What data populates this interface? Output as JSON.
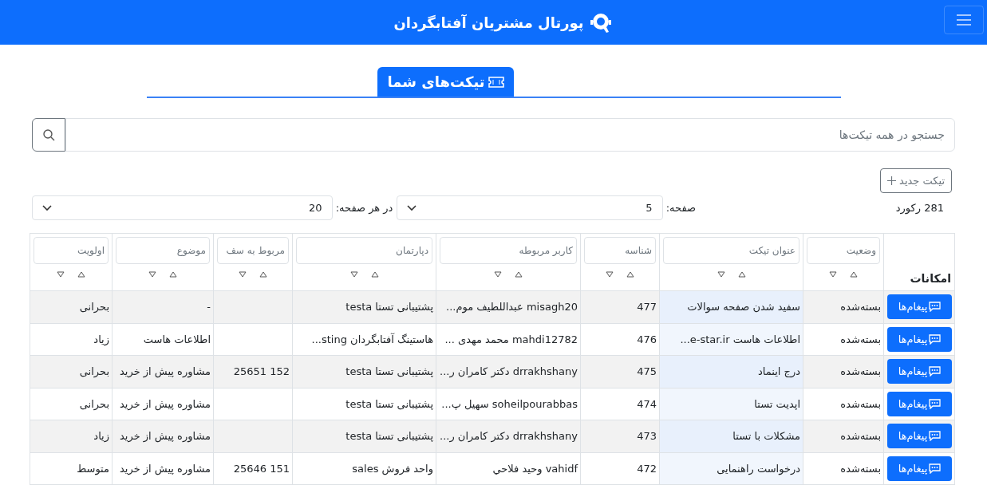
{
  "navbar": {
    "title": "پورتال مشتریان آفتابگردان"
  },
  "page_title": "تیکت‌های شما",
  "search": {
    "placeholder": "جستجو در همه تیکت‌ها"
  },
  "new_ticket_button": {
    "label": "تیکت جدید"
  },
  "record_count": "281 رکورد",
  "page_select": {
    "label": "صفحه:",
    "value": "5"
  },
  "per_page_select": {
    "label": "در هر صفحه:",
    "value": "20"
  },
  "table": {
    "actions_header": "امکانات",
    "columns": [
      {
        "placeholder": "وضعیت"
      },
      {
        "placeholder": "عنوان تیکت"
      },
      {
        "placeholder": "شناسه"
      },
      {
        "placeholder": "کاربر مربوطه"
      },
      {
        "placeholder": "دپارتمان"
      },
      {
        "placeholder": "مربوط به سف"
      },
      {
        "placeholder": "موضوع"
      },
      {
        "placeholder": "اولویت"
      }
    ],
    "rows": [
      {
        "action": "پیغام‌ها",
        "cells": [
          "بسته‌شده",
          "سفید شدن صفحه سوالات",
          "477",
          "misagh20 عبداللطیف موم...",
          "پشتیبانی تستا testa",
          "",
          "-",
          "بحرانی"
        ]
      },
      {
        "action": "پیغام‌ها",
        "cells": [
          "بسته‌شده",
          "اطلاعات هاست e-star.ir...",
          "476",
          "mahdi12782 محمد مهدی ...",
          "هاستینگ آفتابگردان sting...",
          "",
          "اطلاعات هاست",
          "زیاد"
        ]
      },
      {
        "action": "پیغام‌ها",
        "cells": [
          "بسته‌شده",
          "درج اینماد",
          "475",
          "drrakhshany دکتر کامران ر...",
          "پشتیبانی تستا testa",
          "152 25651",
          "مشاوره پیش از خرید",
          "بحرانی"
        ]
      },
      {
        "action": "پیغام‌ها",
        "cells": [
          "بسته‌شده",
          "اپدیت تستا",
          "474",
          "soheilpourabbas سهیل پ...",
          "پشتیبانی تستا testa",
          "",
          "مشاوره پیش از خرید",
          "بحرانی"
        ]
      },
      {
        "action": "پیغام‌ها",
        "cells": [
          "بسته‌شده",
          "مشکلات با تستا",
          "473",
          "drrakhshany دکتر کامران ر...",
          "پشتیبانی تستا testa",
          "",
          "مشاوره پیش از خرید",
          "زیاد"
        ]
      },
      {
        "action": "پیغام‌ها",
        "cells": [
          "بسته‌شده",
          "درخواست راهنمایی",
          "472",
          "vahidf وحيد فلاحي",
          "واحد فروش sales",
          "151 25646",
          "مشاوره پیش از خرید",
          "متوسط"
        ]
      }
    ]
  }
}
